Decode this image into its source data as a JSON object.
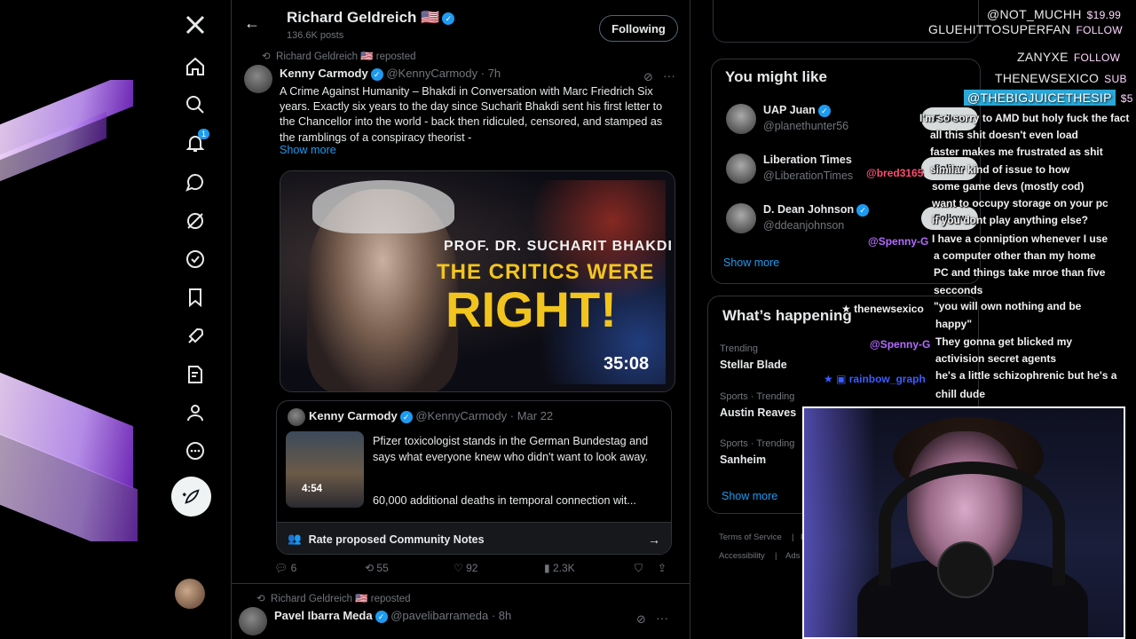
{
  "nav": {
    "notifications_badge": "1",
    "icons": [
      "x-logo-icon",
      "home-icon",
      "search-icon",
      "bell-icon",
      "message-icon",
      "grok-icon",
      "verified-icon",
      "bookmark-icon",
      "rocket-icon",
      "notes-icon",
      "profile-icon",
      "more-icon"
    ]
  },
  "header": {
    "name": "Richard Geldreich",
    "flag": "🇺🇸",
    "posts": "136.6K posts",
    "follow_label": "Following"
  },
  "post1": {
    "repost_by": "Richard Geldreich 🇺🇸 reposted",
    "author": "Kenny Carmody",
    "handle": "@KennyCarmody",
    "time": "· 7h",
    "text": "A Crime Against Humanity – Bhakdi in Conversation with Marc Friedrich Six years. Exactly six years to the day since Sucharit Bhakdi sent his first letter to the Chancellor into the world - back then ridiculed, censored, and stamped as the ramblings of a conspiracy theorist -",
    "show_more": "Show more",
    "media": {
      "line1": "PROF. DR. SUCHARIT BHAKDI",
      "line2": "THE CRITICS WERE",
      "line3": "RIGHT!",
      "duration": "35:08"
    },
    "quote": {
      "author": "Kenny Carmody",
      "handle": "@KennyCarmody",
      "time": "· Mar 22",
      "duration": "4:54",
      "text": "Pfizer toxicologist stands in the German Bundestag and says what everyone knew who didn't want to look away.",
      "text2": "60,000 additional deaths in temporal connection wit..."
    },
    "community_notes": "Rate proposed Community Notes",
    "actions": {
      "replies": "6",
      "reposts": "55",
      "likes": "92",
      "views": "2.3K"
    }
  },
  "post2": {
    "repost_by": "Richard Geldreich 🇺🇸 reposted",
    "author": "Pavel Ibarra Meda",
    "handle": "@pavelibarrameda",
    "time": "· 8h"
  },
  "sidebar": {
    "you_might_like": "You might like",
    "suggestions": [
      {
        "name": "UAP Juan",
        "handle": "@planethunter56",
        "follow": "Follow"
      },
      {
        "name": "Liberation Times",
        "handle": "@LiberationTimes",
        "follow": "Follow"
      },
      {
        "name": "D. Dean Johnson",
        "handle": "@ddeanjohnson",
        "follow": "Follow"
      }
    ],
    "show_more": "Show more",
    "whats_happening": "What’s happening",
    "trends": [
      {
        "context": "Trending",
        "name": "Stellar Blade"
      },
      {
        "context": "Sports · Trending",
        "name": "Austin Reaves"
      },
      {
        "context": "Sports · Trending",
        "name": "Sanheim"
      }
    ],
    "show_more2": "Show more",
    "footer": {
      "terms": "Terms of Service",
      "sep": "|",
      "p": "P",
      "access": "Accessibility",
      "ads": "Ads I"
    }
  },
  "alerts": [
    {
      "name": "@NOT_MUCHH",
      "action": "$19.99"
    },
    {
      "name": "GLUEHITTOSUPERFAN",
      "action": "FOLLOW"
    },
    {
      "name": "ZANYXE",
      "action": "FOLLOW"
    },
    {
      "name": "THENEWSEXICO",
      "action": "SUB"
    },
    {
      "name": "@THEBIGJUICETHESIP",
      "action": "$5"
    }
  ],
  "chat": [
    "I'm so sorry to AMD but holy fuck the fact",
    "all this shit doesn't even load",
    "faster makes me frustrated as shit",
    "@bred3165",
    "similar kind of issue to how",
    "some game devs (mostly cod)",
    "want to occupy storage on your pc",
    "if you dont play anything else?",
    "@Spenny-G",
    "I have a conniption whenever I use",
    "a computer other than my home",
    "PC and things take mroe than five",
    "secconds",
    "thenewsexico",
    "\"you will own nothing and be",
    "happy\"",
    "@Spenny-G",
    "They gonna get blicked my",
    "activision secret agents",
    "rainbow_graph",
    "he's a little schizophrenic but he's a",
    "chill dude"
  ]
}
